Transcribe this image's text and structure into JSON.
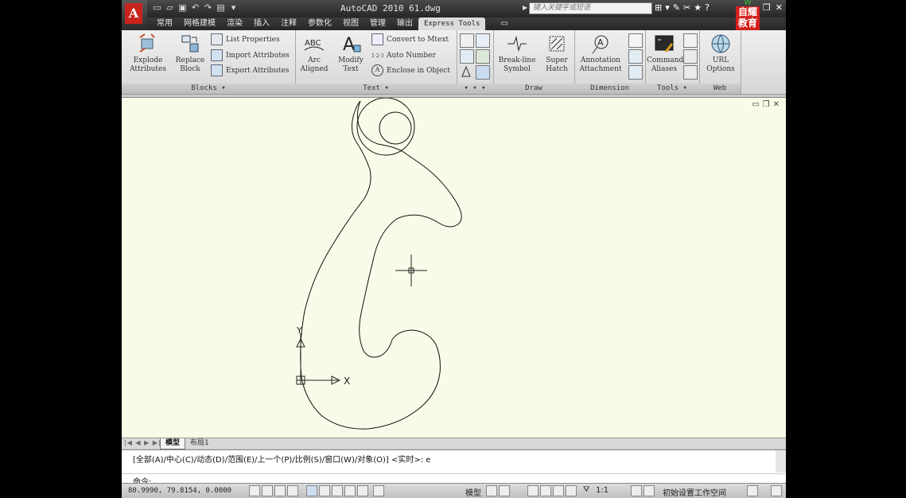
{
  "app": {
    "title": "AutoCAD 2010   61.dwg",
    "search_placeholder": "键入关键字或短语",
    "logo_text": "A",
    "badge_top": "W",
    "badge_text": "自耀教育"
  },
  "tabs": [
    {
      "label": "常用"
    },
    {
      "label": "网格建模"
    },
    {
      "label": "渲染"
    },
    {
      "label": "插入"
    },
    {
      "label": "注释"
    },
    {
      "label": "参数化"
    },
    {
      "label": "视图"
    },
    {
      "label": "管理"
    },
    {
      "label": "输出"
    },
    {
      "label": "Express Tools",
      "active": true
    }
  ],
  "ribbon": {
    "blocks": {
      "title": "Blocks",
      "explode": "Explode\nAttributes",
      "replace": "Replace\nBlock",
      "list_props": "List Properties",
      "import_attr": "Import Attributes",
      "export_attr": "Export Attributes"
    },
    "text": {
      "title": "Text",
      "arc_aligned": "Arc\nAligned",
      "arc_icon_text": "ABC",
      "modify_text": "Modify\nText",
      "convert_mtext": "Convert to Mtext",
      "auto_number": "Auto Number",
      "auto_number_icon": "1·2·3",
      "enclose": "Enclose in Object",
      "enclose_icon": "A"
    },
    "draw": {
      "title": "Draw",
      "breakline": "Break-line\nSymbol",
      "superhatch": "Super\nHatch"
    },
    "dimension": {
      "title": "Dimension",
      "annotation": "Annotation\nAttachment"
    },
    "tools": {
      "title": "Tools",
      "command_aliases": "Command\nAliases"
    },
    "web": {
      "title": "Web",
      "url_options": "URL\nOptions"
    }
  },
  "drawing": {
    "ucs_x_label": "X",
    "ucs_y_label": "Y"
  },
  "layout_tabs": {
    "model": "模型",
    "layout1": "布局1"
  },
  "command": {
    "history": "[全部(A)/中心(C)/动态(D)/范围(E)/上一个(P)/比例(S)/窗口(W)/对象(O)] <实时>: e",
    "prompt": "命令:"
  },
  "status": {
    "coords": "80.9990, 79.8154, 0.0000",
    "model": "模型",
    "scale": "1:1",
    "workspace": "初始设置工作空间"
  }
}
